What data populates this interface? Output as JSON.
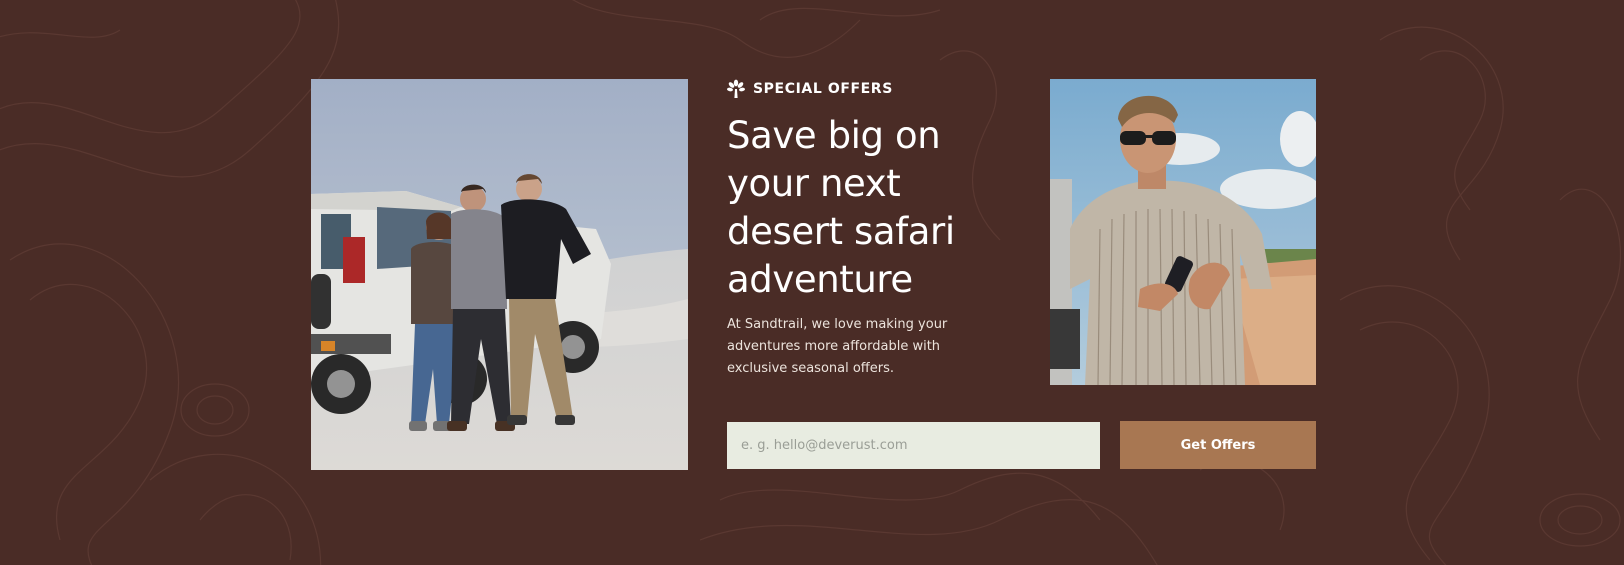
{
  "offer": {
    "eyebrow": "SPECIAL OFFERS",
    "headline": "Save big on your next desert safari adventure",
    "description": "At Sandtrail, we love making your adventures more affordable with exclusive seasonal offers."
  },
  "signup": {
    "placeholder": "e. g. hello@deverust.com",
    "button_label": "Get Offers"
  },
  "colors": {
    "background": "#4a2c26",
    "input_background": "#e8ece1",
    "button": "#a87752",
    "text": "#ffffff"
  },
  "icons": {
    "eyebrow": "palm-tree-icon"
  }
}
